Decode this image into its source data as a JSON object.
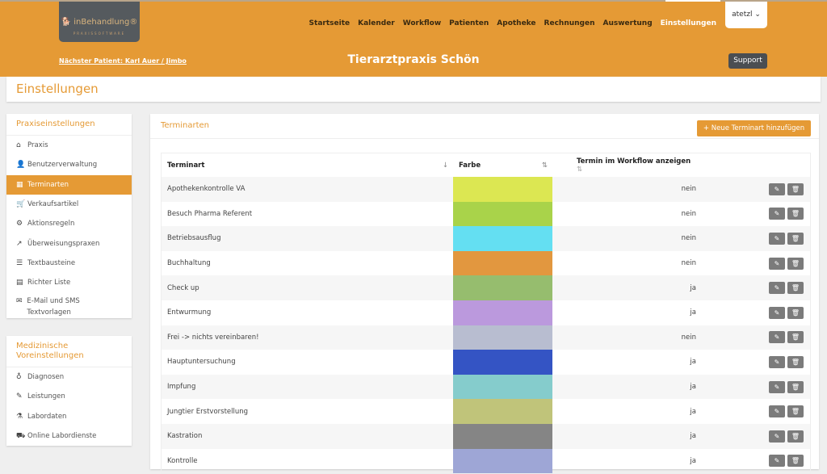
{
  "logo": {
    "name": "inBehandlung",
    "tagline": "PRAXISSOFTWARE"
  },
  "nav": [
    "Startseite",
    "Kalender",
    "Workflow",
    "Patienten",
    "Apotheke",
    "Rechnungen",
    "Auswertung",
    "Einstellungen"
  ],
  "user": "atetzl",
  "next_patient": "Nächster Patient: Karl Auer / Jimbo",
  "practice_title": "Tierarztpraxis Schön",
  "support": "Support",
  "page_title": "Einstellungen",
  "sidebar": [
    {
      "title": "Praxiseinstellungen",
      "items": [
        {
          "icon": "home-icon",
          "glyph": "⌂",
          "label": "Praxis"
        },
        {
          "icon": "user-edit-icon",
          "glyph": "👤",
          "label": "Benutzerverwaltung"
        },
        {
          "icon": "calendar-icon",
          "glyph": "▦",
          "label": "Terminarten",
          "active": true
        },
        {
          "icon": "cart-icon",
          "glyph": "🛒",
          "label": "Verkaufsartikel"
        },
        {
          "icon": "robot-icon",
          "glyph": "⚙",
          "label": "Aktionsregeln"
        },
        {
          "icon": "share-icon",
          "glyph": "↗",
          "label": "Überweisungspraxen"
        },
        {
          "icon": "align-left-icon",
          "glyph": "☰",
          "label": "Textbausteine"
        },
        {
          "icon": "file-export-icon",
          "glyph": "▤",
          "label": "Richter Liste"
        },
        {
          "icon": "envelope-icon",
          "glyph": "✉",
          "label": "E-Mail und SMS Textvorlagen"
        }
      ]
    },
    {
      "title": "Medizinische Voreinstellungen",
      "items": [
        {
          "icon": "stethoscope-icon",
          "glyph": "♁",
          "label": "Diagnosen"
        },
        {
          "icon": "syringe-icon",
          "glyph": "✎",
          "label": "Leistungen"
        },
        {
          "icon": "flask-icon",
          "glyph": "⚗",
          "label": "Labordaten"
        },
        {
          "icon": "truck-icon",
          "glyph": "⛟",
          "label": "Online Labordienste"
        }
      ]
    }
  ],
  "main": {
    "title": "Terminarten",
    "add_button": "+ Neue Terminart hinzufügen",
    "columns": [
      "Terminart",
      "Farbe",
      "Termin im Workflow anzeigen"
    ],
    "rows": [
      {
        "name": "Apothekenkontrolle VA",
        "color": "#dce752",
        "workflow": "nein"
      },
      {
        "name": "Besuch Pharma Referent",
        "color": "#a9d34a",
        "workflow": "nein"
      },
      {
        "name": "Betriebsausflug",
        "color": "#64dff2",
        "workflow": "nein"
      },
      {
        "name": "Buchhaltung",
        "color": "#e2973f",
        "workflow": "nein"
      },
      {
        "name": "Check up",
        "color": "#96bd6e",
        "workflow": "ja"
      },
      {
        "name": "Entwurmung",
        "color": "#bb99dd",
        "workflow": "ja"
      },
      {
        "name": "Frei -> nichts vereinbaren!",
        "color": "#b8bdd0",
        "workflow": "nein"
      },
      {
        "name": "Hauptuntersuchung",
        "color": "#3454c4",
        "workflow": "ja"
      },
      {
        "name": "Impfung",
        "color": "#85cccc",
        "workflow": "ja"
      },
      {
        "name": "Jungtier Erstvorstellung",
        "color": "#c0c47a",
        "workflow": "ja"
      },
      {
        "name": "Kastration",
        "color": "#858585",
        "workflow": "ja"
      },
      {
        "name": "Kontrolle",
        "color": "#9ea6d6",
        "workflow": "ja"
      }
    ]
  }
}
